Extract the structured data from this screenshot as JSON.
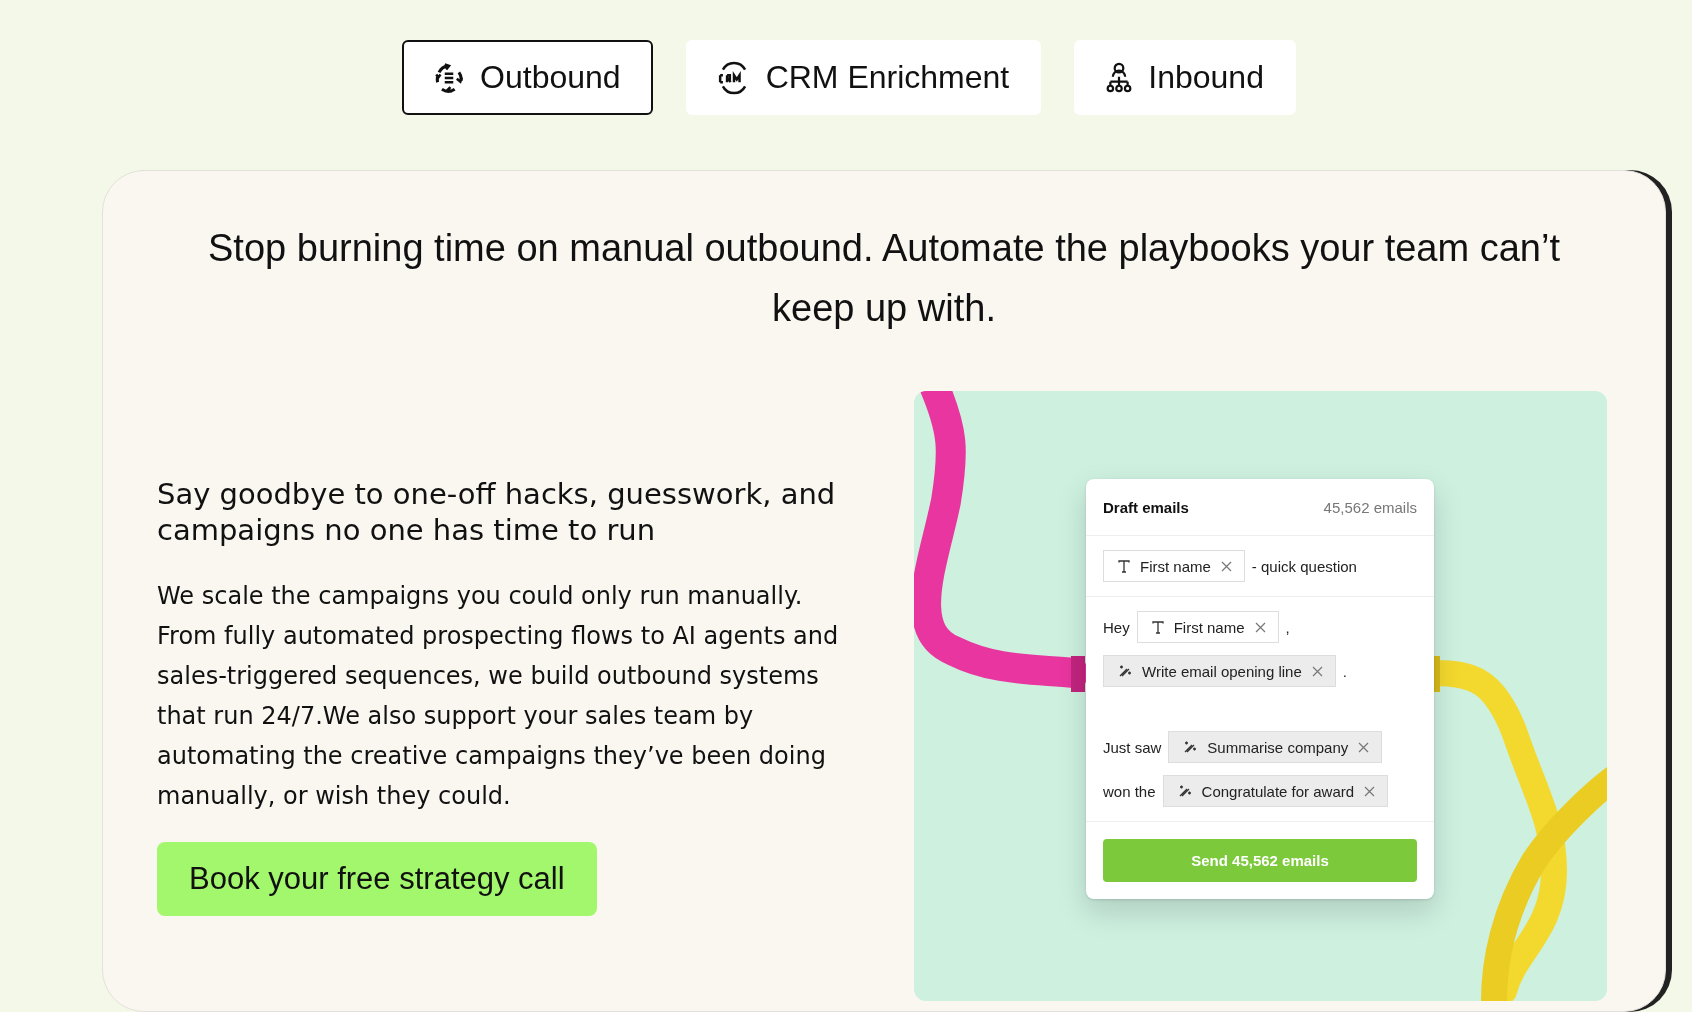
{
  "tabs": [
    {
      "label": "Outbound",
      "selected": true
    },
    {
      "label": "CRM Enrichment",
      "selected": false
    },
    {
      "label": "Inbound",
      "selected": false
    }
  ],
  "headline": "Stop burning time on manual outbound. Automate the playbooks your team can’t keep up with.",
  "subheading": "Say goodbye to one-off hacks, guesswork, and campaigns no one has time to run",
  "body": "We scale the campaigns you could only run manually. From fully automated prospecting flows to AI agents and sales-triggered sequences, we build outbound systems that run 24/7.We also support your sales team by automating the creative campaigns they’ve been doing manually, or wish they could.",
  "cta": "Book your free strategy call",
  "email_card": {
    "title": "Draft emails",
    "count": "45,562 emails",
    "sections": [
      [
        [
          {
            "kind": "variable",
            "label": "First name"
          },
          {
            "kind": "text",
            "label": "- quick question"
          }
        ]
      ],
      [
        [
          {
            "kind": "text",
            "label": "Hey"
          },
          {
            "kind": "variable",
            "label": "First name"
          },
          {
            "kind": "text",
            "label": ","
          }
        ],
        [
          {
            "kind": "ai",
            "label": "Write email opening line"
          },
          {
            "kind": "text",
            "label": "."
          }
        ],
        [
          {
            "kind": "text",
            "label": "Just saw"
          },
          {
            "kind": "ai",
            "label": "Summarise company"
          }
        ],
        [
          {
            "kind": "text",
            "label": "won the"
          },
          {
            "kind": "ai",
            "label": "Congratulate for award"
          }
        ]
      ]
    ],
    "send_button": "Send 45,562 emails"
  }
}
